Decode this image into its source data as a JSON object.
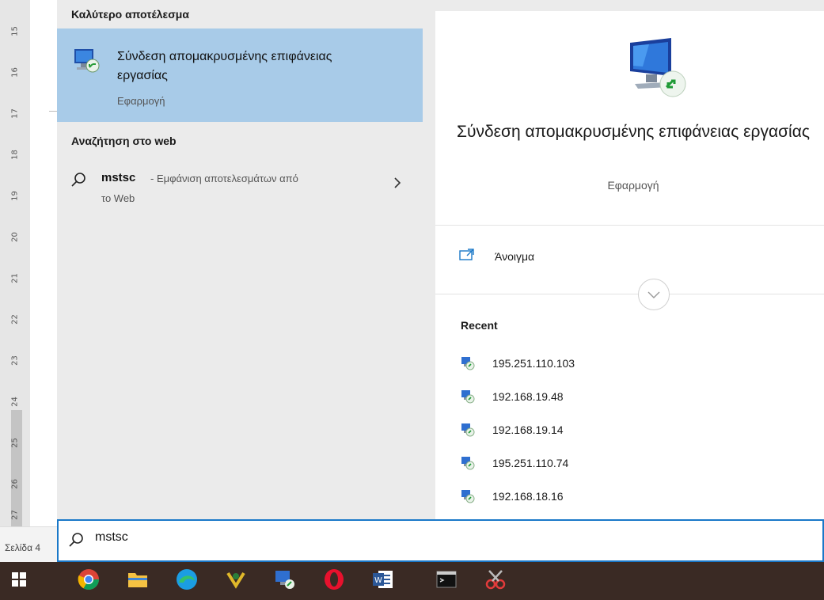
{
  "word": {
    "ruler_numbers": [
      "15",
      "16",
      "17",
      "18",
      "19",
      "20",
      "21",
      "22",
      "23",
      "24",
      "25",
      "26",
      "27"
    ],
    "status_page": "Σελίδα 4"
  },
  "search": {
    "query": "mstsc",
    "best_match_heading": "Καλύτερο αποτέλεσμα",
    "best_match": {
      "title": "Σύνδεση απομακρυσμένης επιφάνειας εργασίας",
      "type": "Εφαρμογή"
    },
    "web_heading": "Αναζήτηση στο web",
    "web_result": {
      "query": "mstsc",
      "suffix_line1": "- Εμφάνιση αποτελεσμάτων από",
      "suffix_line2": "το Web"
    }
  },
  "preview": {
    "title": "Σύνδεση απομακρυσμένης επιφάνειας εργασίας",
    "type": "Εφαρμογή",
    "open_label": "Άνοιγμα",
    "recent_heading": "Recent",
    "recent": [
      "195.251.110.103",
      "192.168.19.48",
      "192.168.19.14",
      "195.251.110.74",
      "192.168.18.16"
    ]
  },
  "taskbar": {
    "apps": [
      "start-icon",
      "chrome-icon",
      "file-explorer-icon",
      "edge-icon",
      "app-icon",
      "remote-desktop-icon",
      "opera-icon",
      "word-icon",
      "terminal-icon",
      "snipping-tool-icon"
    ]
  },
  "colors": {
    "selected_bg": "#a8cbe8",
    "accent": "#1a78c8",
    "taskbar": "#3a2a24"
  }
}
